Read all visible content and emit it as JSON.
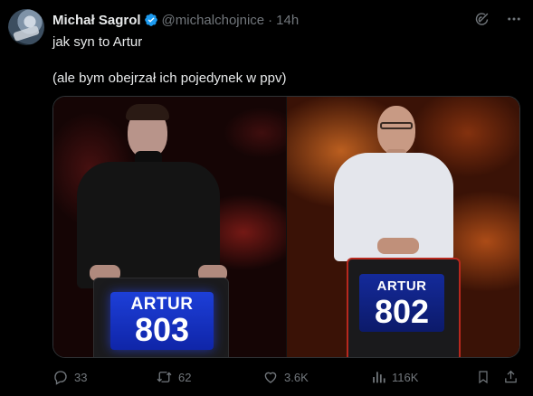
{
  "author": {
    "name": "Michał Sagrol",
    "handle": "@michalchojnice",
    "separator": "·",
    "time": "14h"
  },
  "tweet": {
    "line1": "jak syn to Artur",
    "line2": "(ale bym obejrzał ich pojedynek w ppv)"
  },
  "media": {
    "left": {
      "podium_name": "ARTUR",
      "podium_score": "803"
    },
    "right": {
      "podium_name": "ARTUR",
      "podium_score": "802"
    }
  },
  "actions": {
    "replies": "33",
    "reposts": "62",
    "likes": "3.6K",
    "views": "116K"
  },
  "icons": {
    "verified": "verified-badge-icon",
    "grok": "grok-icon",
    "more": "more-icon",
    "reply": "reply-icon",
    "repost": "repost-icon",
    "like": "heart-icon",
    "views": "views-icon",
    "bookmark": "bookmark-icon",
    "share": "share-icon"
  },
  "colors": {
    "background": "#000000",
    "text": "#e7e9ea",
    "muted": "#71767b",
    "verified": "#1d9bf0",
    "screen_blue": "#1432c8"
  }
}
